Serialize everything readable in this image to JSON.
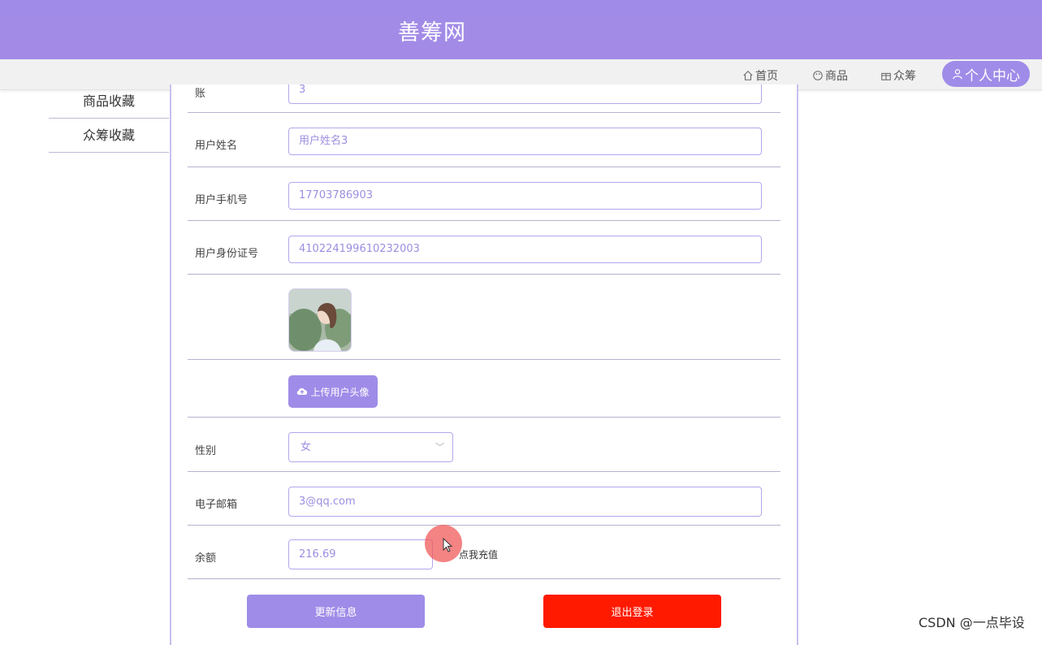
{
  "header": {
    "title": "善筹网"
  },
  "nav": {
    "home": "首页",
    "goods": "商品",
    "crowdfunding": "众筹",
    "personal_center": "个人中心"
  },
  "sidebar": {
    "items": [
      {
        "label": "商品收藏"
      },
      {
        "label": "众筹收藏"
      }
    ]
  },
  "form": {
    "partial_label": "账",
    "partial_value": "3",
    "name": {
      "label": "用户姓名",
      "value": "用户姓名3"
    },
    "phone": {
      "label": "用户手机号",
      "value": "17703786903"
    },
    "idcard": {
      "label": "用户身份证号",
      "value": "410224199610232003"
    },
    "upload_label": "上传用户头像",
    "gender": {
      "label": "性别",
      "value": "女"
    },
    "email": {
      "label": "电子邮箱",
      "value": "3@qq.com"
    },
    "balance": {
      "label": "余额",
      "value": "216.69",
      "recharge_link": "点我充值"
    }
  },
  "buttons": {
    "update": "更新信息",
    "logout": "退出登录"
  },
  "watermark": "CSDN @一点毕设",
  "colors": {
    "accent": "#9f8ce8",
    "danger": "#ff1a00"
  }
}
